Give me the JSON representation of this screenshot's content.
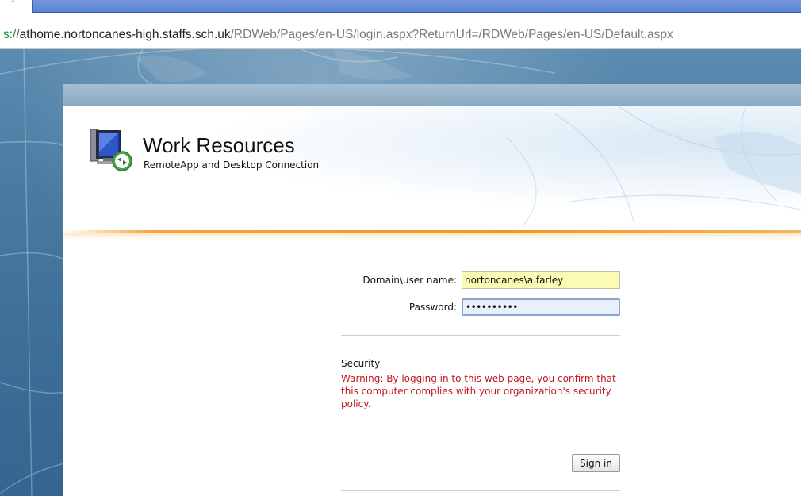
{
  "browser": {
    "url_protocol": "s://",
    "url_host": "athome.nortoncanes-high.staffs.sch.uk",
    "url_path": "/RDWeb/Pages/en-US/login.aspx?ReturnUrl=/RDWeb/Pages/en-US/Default.aspx"
  },
  "header": {
    "title": "Work Resources",
    "subtitle": "RemoteApp and Desktop Connection"
  },
  "form": {
    "username_label": "Domain\\user name:",
    "username_value": "nortoncanes\\a.farley",
    "password_label": "Password:",
    "password_value": "••••••••••",
    "security_title": "Security",
    "security_warning": "Warning: By logging in to this web page, you confirm that this computer complies with your organization's security policy.",
    "signin_label": "Sign in"
  },
  "colors": {
    "accent_orange": "#f29620",
    "warning_red": "#c4151c",
    "username_fill": "#fbfbb6"
  },
  "icons": {
    "app_icon": "remoteapp-monitor-icon"
  }
}
